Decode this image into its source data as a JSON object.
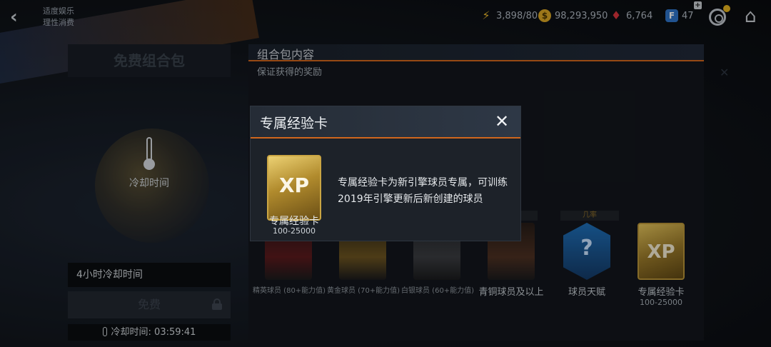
{
  "header": {
    "back_icon": "chevron-left-icon",
    "tags": [
      "适度娱乐",
      "理性消费"
    ],
    "resources": {
      "energy": "3,898",
      "energy_max": "/80",
      "coins": "98,293,950",
      "gems": "6,764",
      "fp_points": "47"
    }
  },
  "left_panel": {
    "title": "免费组合包",
    "cooldown_label": "冷却时间",
    "cooldown_desc": "4小时冷却时间",
    "free_button": "免费",
    "timer": "冷却时间: 03:59:41"
  },
  "content": {
    "title": "组合包内容",
    "subtitle": "保证获得的奖励",
    "prob_label": "几率",
    "rewards": [
      {
        "name": "精英球员 (80+能力值)",
        "type": "red"
      },
      {
        "name": "黄金球员 (70+能力值)",
        "type": "gold"
      },
      {
        "name": "白银球员 (60+能力值)",
        "type": "white"
      },
      {
        "name": "青铜球员及以上",
        "type": "bronze"
      },
      {
        "name": "球员天赋",
        "type": "blue",
        "glyph": "?"
      },
      {
        "name": "专属经验卡",
        "sub": "100-25000",
        "type": "xp",
        "glyph": "XP"
      }
    ]
  },
  "modal": {
    "title": "专属经验卡",
    "close_glyph": "✕",
    "card_glyph": "XP",
    "card_name": "专属经验卡",
    "card_range": "100-25000",
    "description": "专属经验卡为新引擎球员专属，可训练2019年引擎更新后新创建的球员"
  },
  "colors": {
    "accent_orange": "#d0661d",
    "gold": "#d9a625",
    "gem_red": "#d8343c",
    "fp_blue": "#2f74c8"
  }
}
